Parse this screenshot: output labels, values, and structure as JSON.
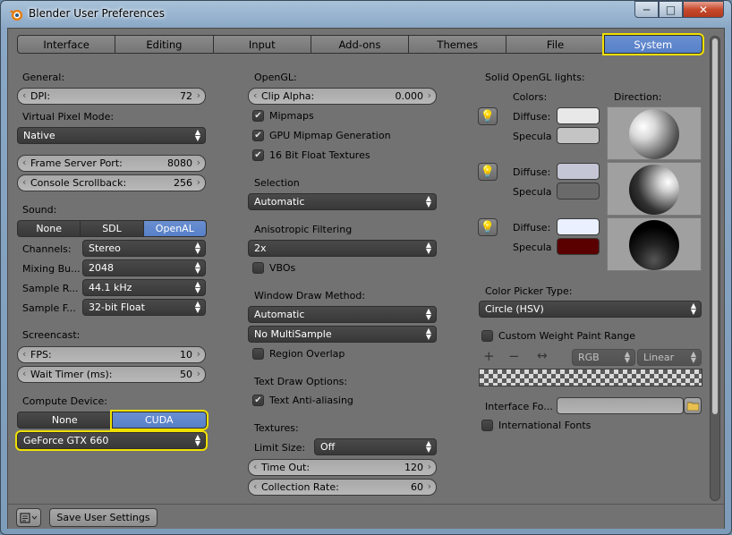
{
  "window": {
    "title": "Blender User Preferences",
    "min": "─",
    "max": "□",
    "close": "✕"
  },
  "tabs": [
    {
      "label": "Interface"
    },
    {
      "label": "Editing"
    },
    {
      "label": "Input"
    },
    {
      "label": "Add-ons"
    },
    {
      "label": "Themes"
    },
    {
      "label": "File"
    },
    {
      "label": "System",
      "active": true
    }
  ],
  "col1": {
    "general": "General:",
    "dpi": {
      "label": "DPI:",
      "value": "72"
    },
    "vpm": {
      "label": "Virtual Pixel Mode:",
      "value": "Native"
    },
    "fsp": {
      "label": "Frame Server Port:",
      "value": "8080"
    },
    "cs": {
      "label": "Console Scrollback:",
      "value": "256"
    },
    "sound": "Sound:",
    "sound_opts": [
      "None",
      "SDL",
      "OpenAL"
    ],
    "channels": {
      "label": "Channels:",
      "value": "Stereo"
    },
    "mixing": {
      "label": "Mixing Bu...",
      "value": "2048"
    },
    "sample_rate": {
      "label": "Sample R...",
      "value": "44.1 kHz"
    },
    "sample_format": {
      "label": "Sample F...",
      "value": "32-bit Float"
    },
    "screencast": "Screencast:",
    "fps": {
      "label": "FPS:",
      "value": "10"
    },
    "wait": {
      "label": "Wait Timer (ms):",
      "value": "50"
    },
    "compute": "Compute Device:",
    "compute_opts": [
      "None",
      "CUDA"
    ],
    "gpu": "GeForce GTX 660"
  },
  "col2": {
    "opengl": "OpenGL:",
    "clip": {
      "label": "Clip Alpha:",
      "value": "0.000"
    },
    "mipmaps": "Mipmaps",
    "gpu_mipmap": "GPU Mipmap Generation",
    "float16": "16 Bit Float Textures",
    "selection": "Selection",
    "selection_val": "Automatic",
    "aniso": "Anisotropic Filtering",
    "aniso_val": "2x",
    "vbos": "VBOs",
    "wdm": "Window Draw Method:",
    "wdm_val": "Automatic",
    "multisample": "No MultiSample",
    "region_overlap": "Region Overlap",
    "text_draw": "Text Draw Options:",
    "text_aa": "Text Anti-aliasing",
    "textures": "Textures:",
    "limit_size": {
      "label": "Limit Size:",
      "value": "Off"
    },
    "timeout": {
      "label": "Time Out:",
      "value": "120"
    },
    "collection": {
      "label": "Collection Rate:",
      "value": "60"
    }
  },
  "col3": {
    "solid_lights": "Solid OpenGL lights:",
    "colors": "Colors:",
    "direction": "Direction:",
    "diffuse": "Diffuse:",
    "specular": "Specula",
    "lights": [
      {
        "diffuse": "#e8e8e8",
        "specular": "#c4c4c4"
      },
      {
        "diffuse": "#c4c6d6",
        "specular": "#6a6a6a"
      },
      {
        "diffuse": "#eaf0ff",
        "specular": "#5a0000"
      }
    ],
    "color_picker": "Color Picker Type:",
    "color_picker_val": "Circle (HSV)",
    "cwpr": "Custom Weight Paint Range",
    "plus": "+",
    "minus": "−",
    "swap": "↔",
    "rgb": "RGB",
    "linear": "Linear",
    "interface_font": "Interface Fo...",
    "intl_fonts": "International Fonts"
  },
  "bottom": {
    "save": "Save User Settings"
  }
}
